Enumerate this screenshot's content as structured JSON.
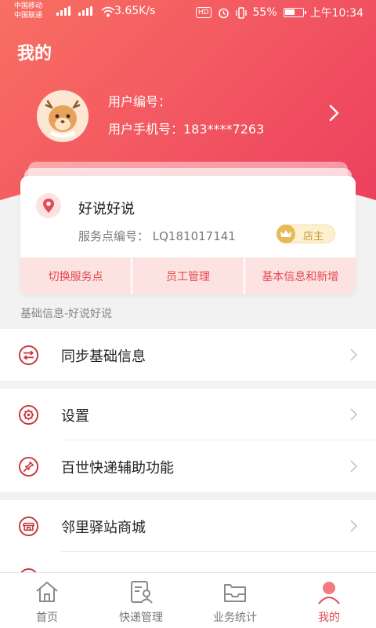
{
  "status_bar": {
    "carrier_1": "中国移动",
    "carrier_2": "中国联通",
    "net_1": "4G",
    "net_2": "3G",
    "speed": "3.65K/s",
    "hd": "HD",
    "battery_pct": "55%",
    "time": "上午10:34"
  },
  "header": {
    "title": "我的",
    "user_id_label": "用户编号：",
    "user_phone_label": "用户手机号：183****7263"
  },
  "station": {
    "name": "好说好说",
    "code_label": "服务点编号：  LQ181017141",
    "owner_label": "店主",
    "actions": [
      "切换服务点",
      "员工管理",
      "基本信息和新增"
    ]
  },
  "section_caption": "基础信息-好说好说",
  "menu": {
    "sync": "同步基础信息",
    "settings": "设置",
    "assist": "百世快递辅助功能",
    "mall": "邻里驿站商城"
  },
  "bottom_nav": {
    "home": "首页",
    "express": "快递管理",
    "stats": "业务统计",
    "mine": "我的"
  },
  "colors": {
    "accent": "#e54a52",
    "header_start": "#f86f62",
    "header_end": "#ec3f5d",
    "action_bg": "#fde2e2",
    "gold": "#e7b957"
  }
}
